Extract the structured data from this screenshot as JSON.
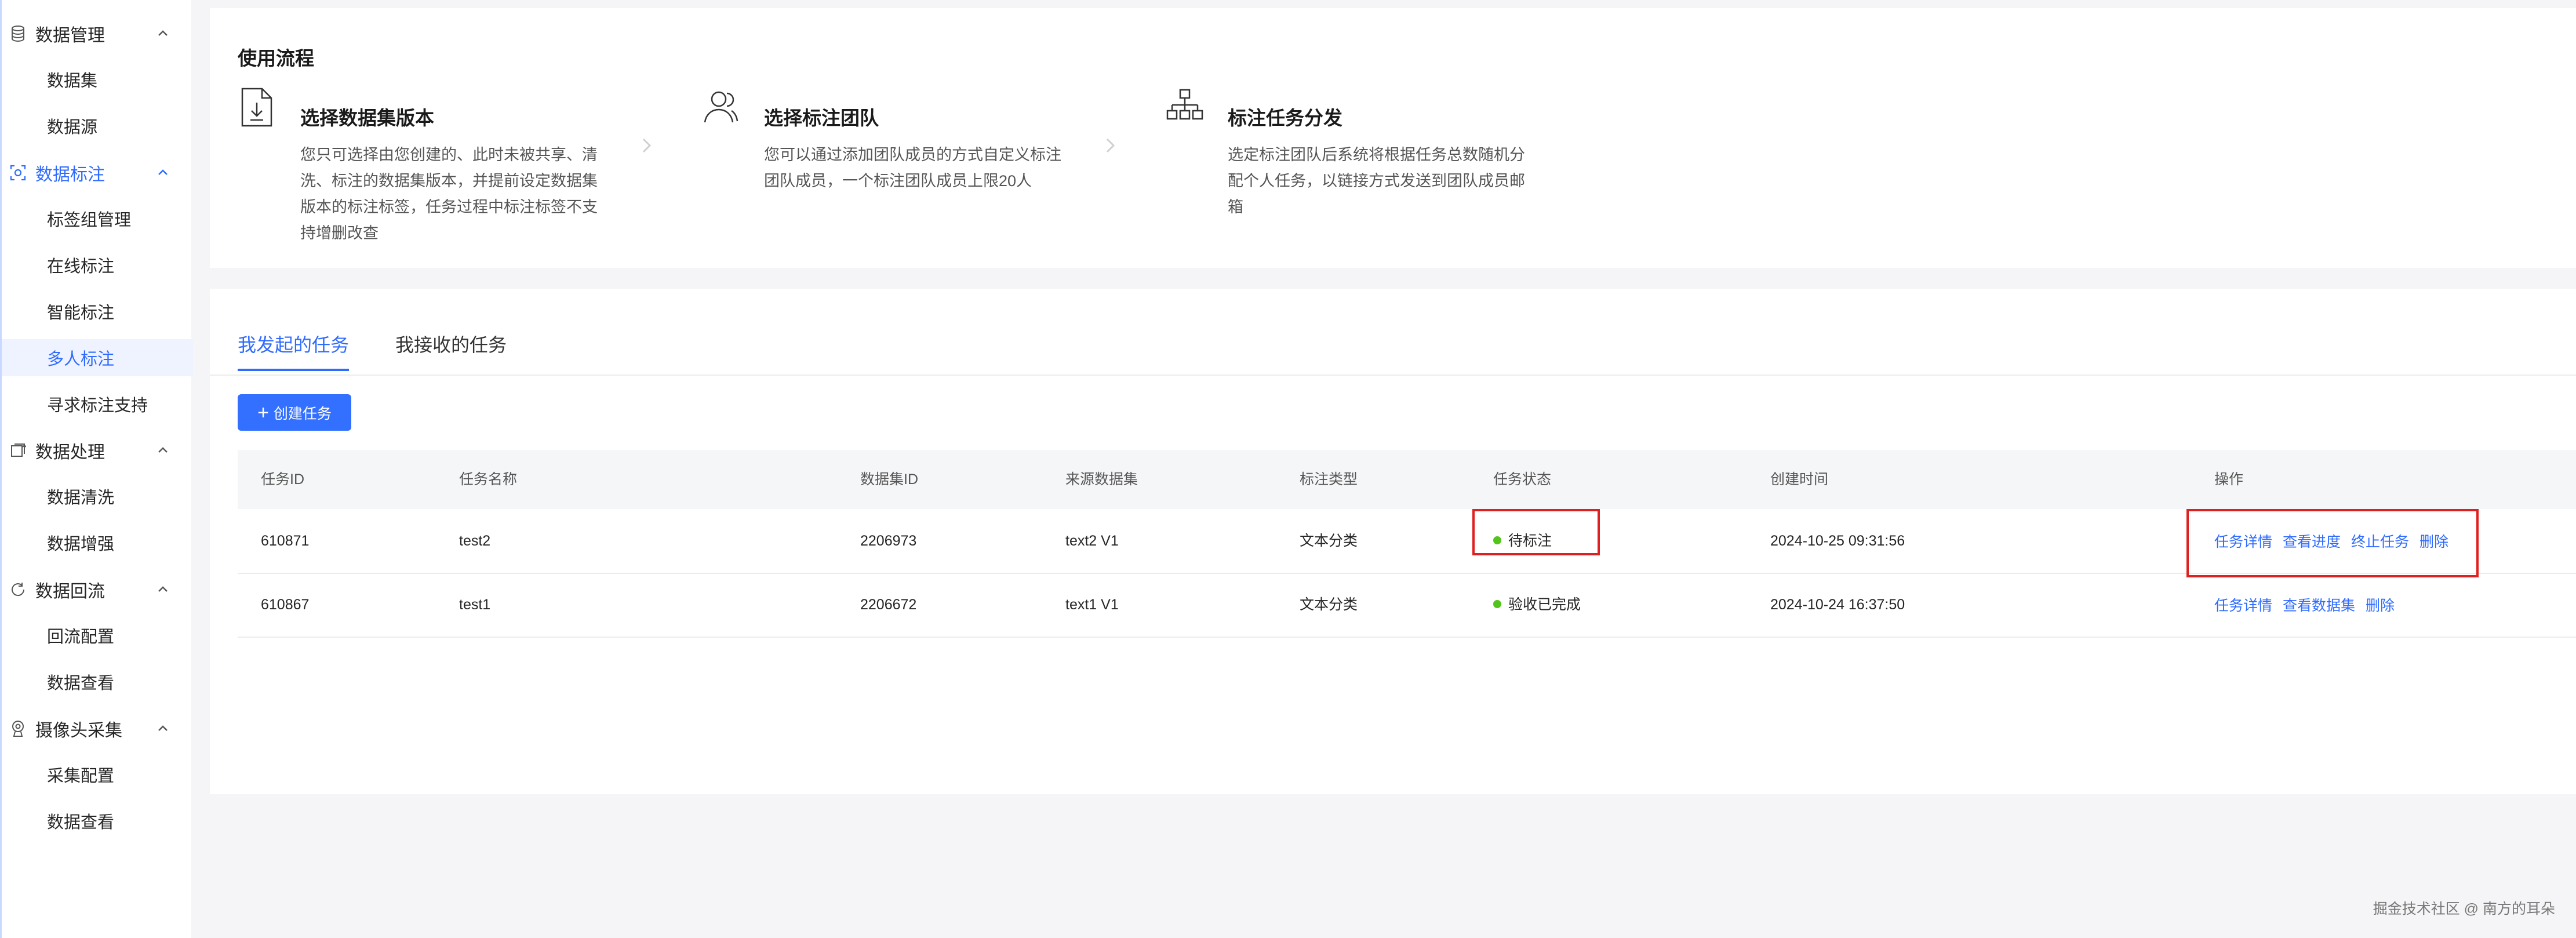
{
  "sidebar": {
    "groups": [
      {
        "label": "数据管理",
        "icon": "database-icon",
        "items": [
          "数据集",
          "数据源"
        ]
      },
      {
        "label": "数据标注",
        "icon": "annotation-icon",
        "items": [
          "标签组管理",
          "在线标注",
          "智能标注",
          "多人标注",
          "寻求标注支持"
        ]
      },
      {
        "label": "数据处理",
        "icon": "processing-icon",
        "items": [
          "数据清洗",
          "数据增强"
        ]
      },
      {
        "label": "数据回流",
        "icon": "reflow-icon",
        "items": [
          "回流配置",
          "数据查看"
        ]
      },
      {
        "label": "摄像头采集",
        "icon": "camera-icon",
        "items": [
          "采集配置",
          "数据查看"
        ]
      }
    ],
    "active_group": "数据标注",
    "selected_item": "多人标注"
  },
  "flow": {
    "title": "使用流程",
    "steps": [
      {
        "icon": "document-download-icon",
        "title": "选择数据集版本",
        "desc": "您只可选择由您创建的、此时未被共享、清洗、标注的数据集版本，并提前设定数据集版本的标注标签，任务过程中标注标签不支持增删改查"
      },
      {
        "icon": "team-icon",
        "title": "选择标注团队",
        "desc": "您可以通过添加团队成员的方式自定义标注团队成员，一个标注团队成员上限20人"
      },
      {
        "icon": "org-chart-icon",
        "title": "标注任务分发",
        "desc": "选定标注团队后系统将根据任务总数随机分配个人任务，以链接方式发送到团队成员邮箱"
      }
    ]
  },
  "tabs": [
    "我发起的任务",
    "我接收的任务"
  ],
  "active_tab": "我发起的任务",
  "create_button": {
    "plus": "+",
    "label": "创建任务"
  },
  "table": {
    "headers": [
      "任务ID",
      "任务名称",
      "数据集ID",
      "来源数据集",
      "标注类型",
      "任务状态",
      "创建时间",
      "操作"
    ],
    "rows": [
      {
        "id": "610871",
        "name": "test2",
        "dataset_id": "2206973",
        "source": "text2 V1",
        "type": "文本分类",
        "status": "待标注",
        "status_color": "#52c41a",
        "created": "2024-10-25 09:31:56",
        "ops": [
          "任务详情",
          "查看进度",
          "终止任务",
          "删除"
        ]
      },
      {
        "id": "610867",
        "name": "test1",
        "dataset_id": "2206672",
        "source": "text1 V1",
        "type": "文本分类",
        "status": "验收已完成",
        "status_color": "#52c41a",
        "created": "2024-10-24 16:37:50",
        "ops": [
          "任务详情",
          "查看数据集",
          "删除"
        ]
      }
    ]
  },
  "accent_color": "#2f6bff",
  "highlight_color": "#e02020",
  "watermark": "掘金技术社区 @ 南方的耳朵"
}
